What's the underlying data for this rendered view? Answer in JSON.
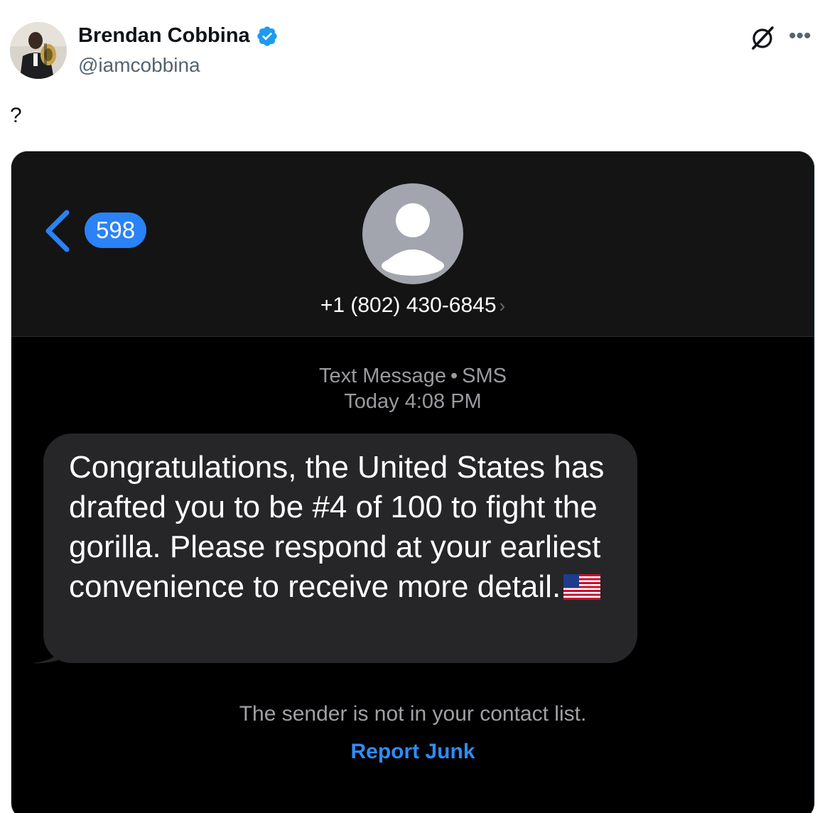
{
  "tweet": {
    "author_name": "Brendan Cobbina",
    "handle": "@iamcobbina",
    "text": "?",
    "icons": {
      "verified": "verified-badge-icon",
      "grok": "grok-icon",
      "more": "more-options-icon"
    },
    "colors": {
      "verified": "#1d9bf0",
      "name": "#0f1419",
      "handle": "#536471"
    }
  },
  "screenshot": {
    "unread_count": "598",
    "contact_number": "+1 (802) 430-6845",
    "contact_chevron": "›",
    "message_type": "Text Message",
    "separator": "•",
    "message_service": "SMS",
    "timestamp": "Today 4:08 PM",
    "message_text": "Congratulations, the United States has drafted you to be #4 of 100 to fight the gorilla. Please respond at your earliest convenience to receive more detail.",
    "message_emoji": "us-flag",
    "notice": "The sender is not in your contact list.",
    "report_junk": "Report Junk",
    "colors": {
      "background": "#000000",
      "bubble": "#262628",
      "accent_blue": "#2a82f7",
      "link_blue": "#2f8cf5"
    }
  }
}
